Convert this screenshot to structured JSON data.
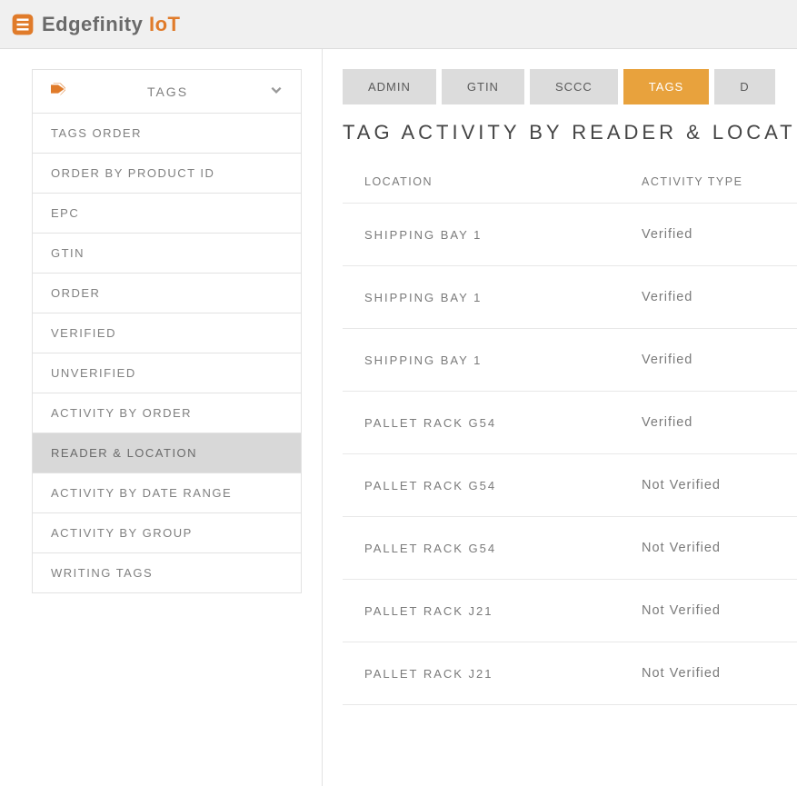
{
  "brand": {
    "name": "Edgefinity",
    "suffix": "IoT"
  },
  "sidebar": {
    "title": "TAGS",
    "items": [
      {
        "label": "TAGS ORDER",
        "active": false,
        "id": "tags-order"
      },
      {
        "label": "ORDER BY PRODUCT ID",
        "active": false,
        "id": "order-by-product-id"
      },
      {
        "label": "EPC",
        "active": false,
        "id": "epc"
      },
      {
        "label": "GTIN",
        "active": false,
        "id": "gtin"
      },
      {
        "label": "ORDER",
        "active": false,
        "id": "order"
      },
      {
        "label": "VERIFIED",
        "active": false,
        "id": "verified"
      },
      {
        "label": "UNVERIFIED",
        "active": false,
        "id": "unverified"
      },
      {
        "label": "ACTIVITY BY ORDER",
        "active": false,
        "id": "activity-by-order"
      },
      {
        "label": "READER & LOCATION",
        "active": true,
        "id": "reader-location"
      },
      {
        "label": "ACTIVITY BY DATE RANGE",
        "active": false,
        "id": "activity-by-date-range"
      },
      {
        "label": "ACTIVITY BY GROUP",
        "active": false,
        "id": "activity-by-group"
      },
      {
        "label": "WRITING TAGS",
        "active": false,
        "id": "writing-tags"
      }
    ]
  },
  "tabs": [
    {
      "label": "ADMIN",
      "active": false,
      "id": "admin"
    },
    {
      "label": "GTIN",
      "active": false,
      "id": "gtin"
    },
    {
      "label": "SCCC",
      "active": false,
      "id": "sccc"
    },
    {
      "label": "TAGS",
      "active": true,
      "id": "tags"
    },
    {
      "label": "D",
      "active": false,
      "id": "d"
    }
  ],
  "page": {
    "title": "TAG ACTIVITY BY READER & LOCATION"
  },
  "table": {
    "headers": {
      "location": "LOCATION",
      "activity_type": "ACTIVITY TYPE"
    },
    "rows": [
      {
        "location": "SHIPPING BAY 1",
        "activity_type": "Verified"
      },
      {
        "location": "SHIPPING BAY 1",
        "activity_type": "Verified"
      },
      {
        "location": "SHIPPING BAY 1",
        "activity_type": "Verified"
      },
      {
        "location": "PALLET RACK G54",
        "activity_type": "Verified"
      },
      {
        "location": "PALLET RACK G54",
        "activity_type": "Not Verified"
      },
      {
        "location": "PALLET RACK G54",
        "activity_type": "Not Verified"
      },
      {
        "location": "PALLET RACK J21",
        "activity_type": "Not Verified"
      },
      {
        "location": "PALLET RACK J21",
        "activity_type": "Not Verified"
      }
    ]
  }
}
